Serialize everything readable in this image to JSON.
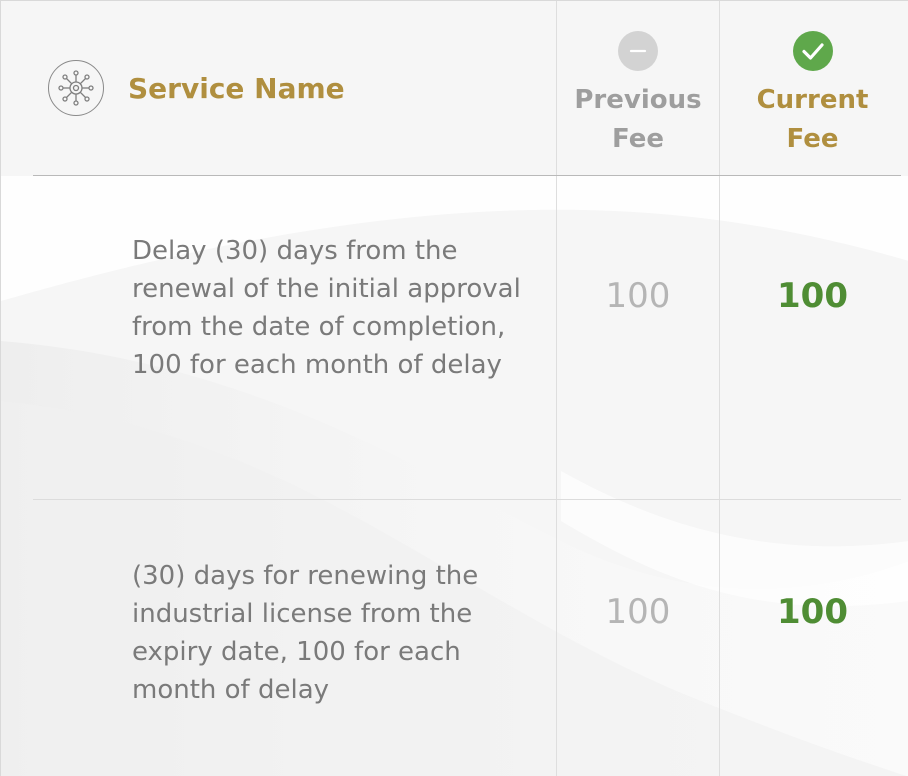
{
  "header": {
    "service_label": "Service Name",
    "previous_label_line1": "Previous",
    "previous_label_line2": "Fee",
    "current_label_line1": "Current",
    "current_label_line2": "Fee"
  },
  "rows": [
    {
      "description": "Delay (30) days from the renewal of the initial approval from the date of completion, 100 for each month of delay",
      "previous_fee": "100",
      "current_fee": "100"
    },
    {
      "description": "(30) days for renewing the industrial license from the expiry date, 100 for each month of delay",
      "previous_fee": "100",
      "current_fee": "100"
    }
  ],
  "colors": {
    "accent_gold": "#b08f3f",
    "current_green": "#4f8d34",
    "check_green": "#5fa84b",
    "muted_gray": "#9e9e9e"
  },
  "icons": {
    "service": "network-gear-icon",
    "previous": "minus-circle-icon",
    "current": "check-circle-icon"
  }
}
